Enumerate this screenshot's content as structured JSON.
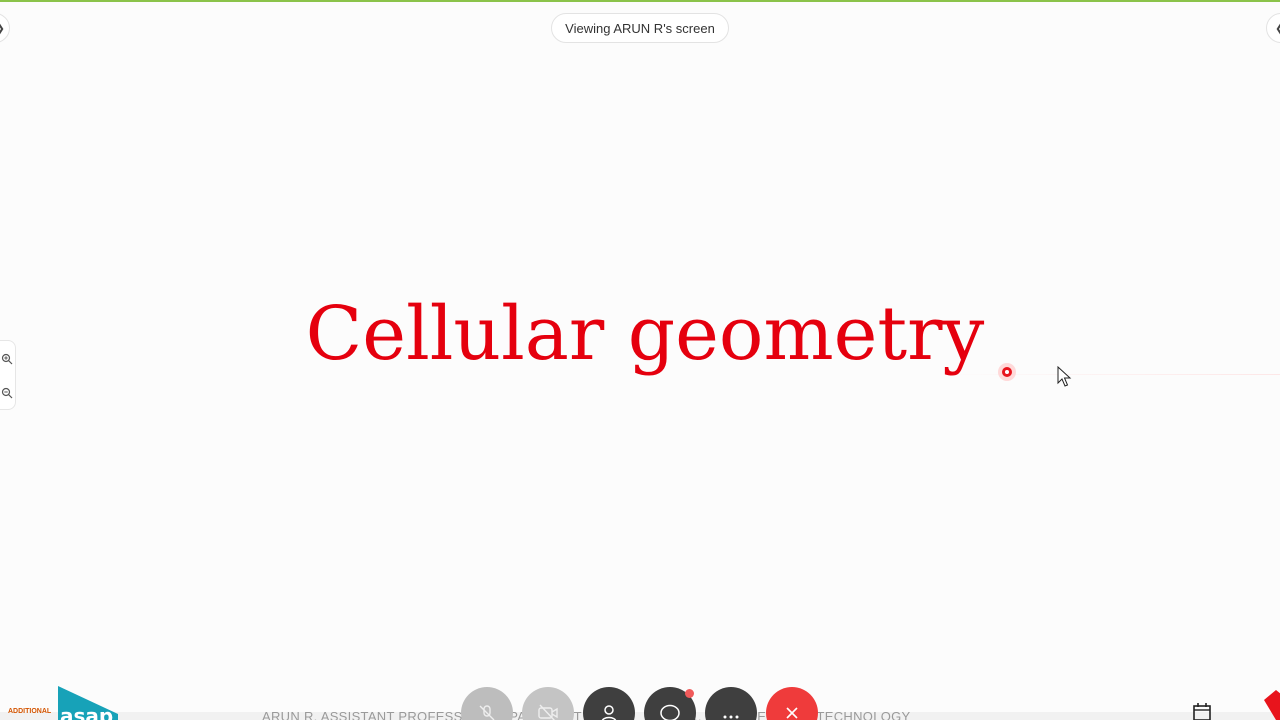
{
  "banner": {
    "viewing_text": "Viewing ARUN R's screen"
  },
  "slide": {
    "title": "Cellular geometry",
    "title_color": "#e5000e"
  },
  "footer": {
    "presenter_text_left": "ARUN R, ASSISTANT PROFESSOR, DEPARTMENT",
    "presenter_text_right": "... ENGINEERING & TECHNOLOGY"
  },
  "logo": {
    "small_text": "ADDITIONAL",
    "brand_text": "asap"
  },
  "controls": [
    {
      "name": "mute-button",
      "icon": "microphone-off-icon"
    },
    {
      "name": "video-button",
      "icon": "video-off-icon"
    },
    {
      "name": "participants-button",
      "icon": "person-icon"
    },
    {
      "name": "chat-button",
      "icon": "chat-bubble-icon"
    },
    {
      "name": "more-options-button",
      "icon": "ellipsis-icon"
    },
    {
      "name": "end-call-button",
      "icon": "close-icon"
    }
  ],
  "colors": {
    "accent_top_line": "#8bc34a",
    "end_call": "#ef3b3b",
    "control_dark": "#3f3f3f",
    "notification_dot": "#f05a5a"
  }
}
